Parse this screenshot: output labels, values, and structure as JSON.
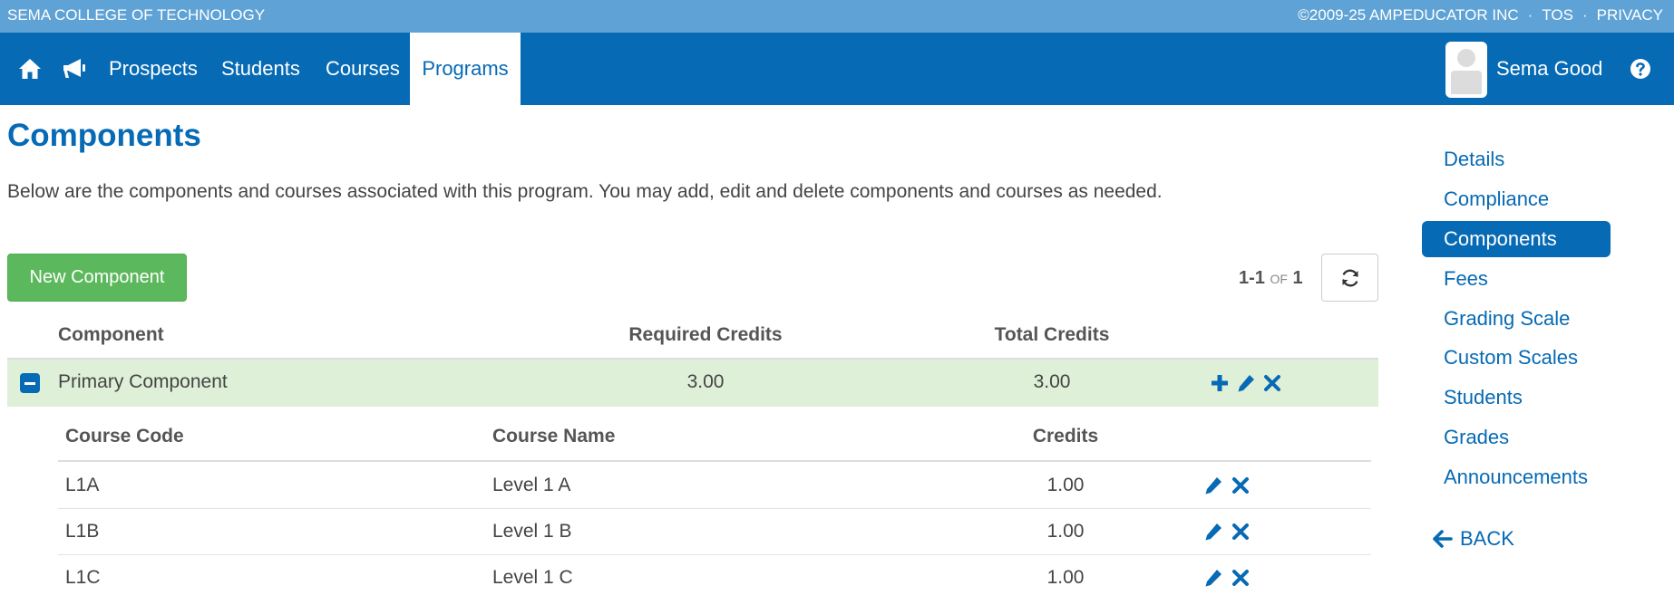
{
  "topbar": {
    "school": "SEMA COLLEGE OF TECHNOLOGY",
    "copyright": "©2009-25 AMPEDUCATOR INC",
    "sep": "·",
    "tos": "TOS",
    "privacy": "PRIVACY"
  },
  "nav": {
    "items": [
      {
        "label": "Prospects"
      },
      {
        "label": "Students"
      },
      {
        "label": "Courses"
      },
      {
        "label": "Programs",
        "active": true
      }
    ],
    "user": "Sema Good",
    "icons": [
      "home-icon",
      "megaphone-icon",
      "help-icon"
    ]
  },
  "page": {
    "title": "Components",
    "description": "Below are the components and courses associated with this program. You may add, edit and delete components and courses as needed.",
    "new_button": "New Component",
    "paging": {
      "range": "1-1",
      "of": "OF",
      "total": "1"
    }
  },
  "components_table": {
    "headers": [
      "Component",
      "Required Credits",
      "Total Credits"
    ],
    "rows": [
      {
        "component": "Primary Component",
        "required_credits": "3.00",
        "total_credits": "3.00"
      }
    ]
  },
  "courses_table": {
    "headers": [
      "Course Code",
      "Course Name",
      "Credits"
    ],
    "rows": [
      {
        "code": "L1A",
        "name": "Level 1 A",
        "credits": "1.00"
      },
      {
        "code": "L1B",
        "name": "Level 1 B",
        "credits": "1.00"
      },
      {
        "code": "L1C",
        "name": "Level 1 C",
        "credits": "1.00"
      }
    ]
  },
  "sidebar": {
    "items": [
      {
        "label": "Details"
      },
      {
        "label": "Compliance"
      },
      {
        "label": "Components",
        "active": true
      },
      {
        "label": "Fees"
      },
      {
        "label": "Grading Scale"
      },
      {
        "label": "Custom Scales"
      },
      {
        "label": "Students"
      },
      {
        "label": "Grades"
      },
      {
        "label": "Announcements"
      }
    ],
    "back": "BACK"
  },
  "colors": {
    "primary": "#066ab4",
    "topbar": "#5fa3d6",
    "success": "#5cb85c",
    "row_highlight": "#dff0d8"
  }
}
